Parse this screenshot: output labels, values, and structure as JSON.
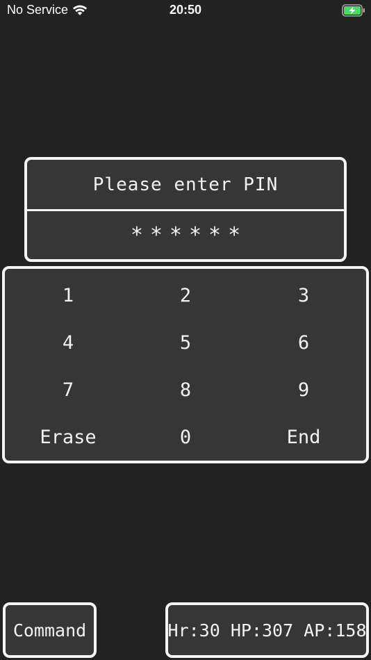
{
  "status_bar": {
    "carrier": "No Service",
    "time": "20:50",
    "wifi_icon": "wifi-icon",
    "battery_icon": "battery-charging-icon",
    "battery_color": "#4cd964"
  },
  "pin_panel": {
    "prompt": "Please enter PIN",
    "masked_value": "******"
  },
  "keypad": {
    "keys": [
      {
        "label": "1"
      },
      {
        "label": "2"
      },
      {
        "label": "3"
      },
      {
        "label": "4"
      },
      {
        "label": "5"
      },
      {
        "label": "6"
      },
      {
        "label": "7"
      },
      {
        "label": "8"
      },
      {
        "label": "9"
      },
      {
        "label": "Erase"
      },
      {
        "label": "0"
      },
      {
        "label": "End"
      }
    ]
  },
  "footer": {
    "command_label": "Command",
    "stats_label": "Hr:30 HP:307 AP:158"
  },
  "colors": {
    "background": "#222222",
    "panel": "#363636",
    "border": "#f4f4f4",
    "text": "#f2f2f2"
  }
}
